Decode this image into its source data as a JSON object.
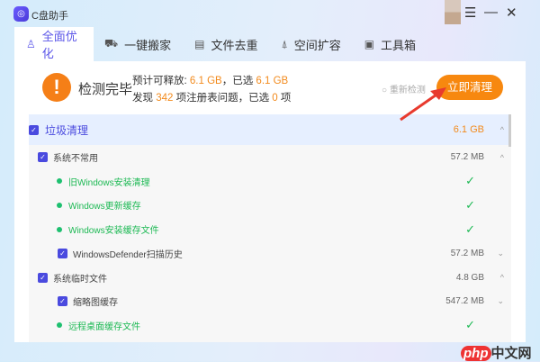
{
  "app": {
    "title": "C盘助手",
    "logo_icon": "c-drive-logo-icon"
  },
  "window": {
    "menu": "☰",
    "minimize": "—",
    "close": "✕"
  },
  "tabs": [
    {
      "label": "全面优化",
      "icon": "♙"
    },
    {
      "label": "一键搬家",
      "icon": "⛟"
    },
    {
      "label": "文件去重",
      "icon": "▤"
    },
    {
      "label": "空间扩容",
      "icon": "⍋"
    },
    {
      "label": "工具箱",
      "icon": "▣"
    }
  ],
  "summary": {
    "status": "检测完毕",
    "l1_pre": "预计可释放:",
    "l1_v1": "6.1 GB",
    "l1_mid": "，已选",
    "l1_v2": "6.1 GB",
    "l2_pre": "发现",
    "l2_v1": "342",
    "l2_mid": "项注册表问题，已选",
    "l2_v2": "0",
    "l2_post": "项",
    "rescan": "重新检测",
    "clean": "立即清理"
  },
  "list": {
    "category": {
      "label": "垃圾清理",
      "size": "6.1 GB",
      "color": "#f28a1c"
    },
    "rows": [
      {
        "type": "group",
        "label": "系统不常用",
        "size": "57.2 MB",
        "chev": "^"
      },
      {
        "type": "done",
        "label": "旧Windows安装清理"
      },
      {
        "type": "done",
        "label": "Windows更新缓存"
      },
      {
        "type": "done",
        "label": "Windows安装缓存文件"
      },
      {
        "type": "item",
        "label": "WindowsDefender扫描历史",
        "size": "57.2 MB",
        "chev": "v"
      },
      {
        "type": "group",
        "label": "系统临时文件",
        "size": "4.8 GB",
        "chev": "^"
      },
      {
        "type": "item",
        "label": "缩略图缓存",
        "size": "547.2 MB",
        "chev": "v"
      },
      {
        "type": "done",
        "label": "远程桌面缓存文件"
      }
    ]
  },
  "watermark": {
    "a": "php",
    "b": "中文网"
  }
}
